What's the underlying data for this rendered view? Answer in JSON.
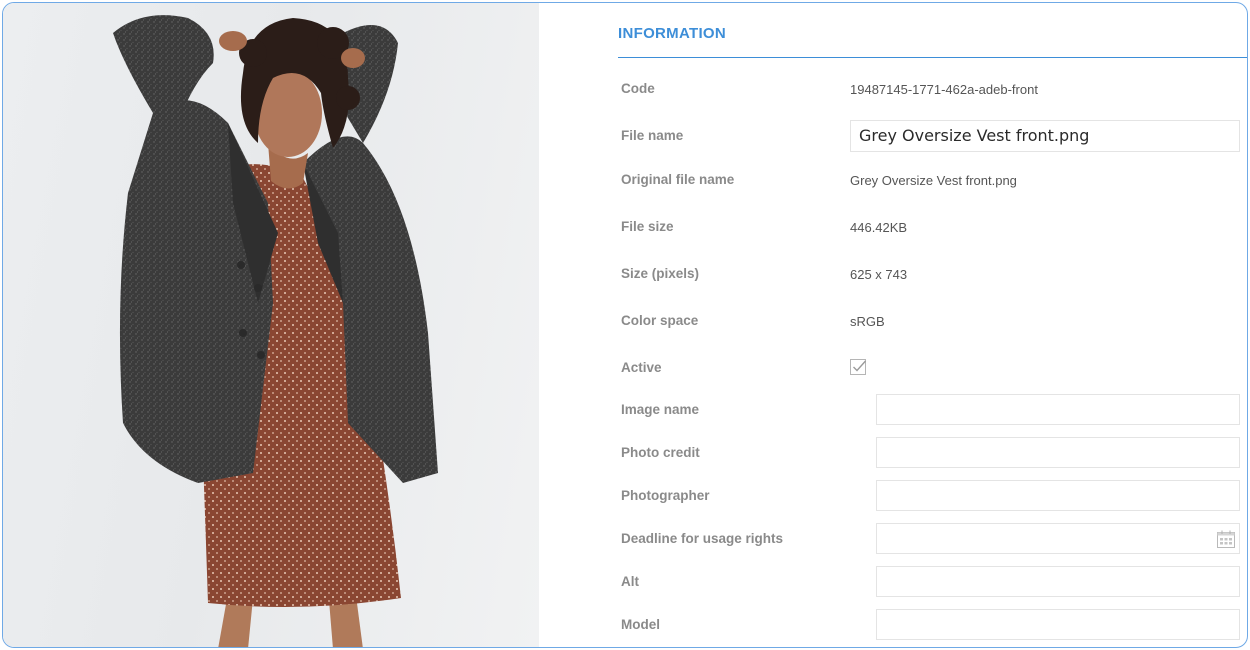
{
  "info": {
    "title": "INFORMATION",
    "fields": [
      {
        "label": "Code",
        "value": "19487145-1771-462a-adeb-front"
      },
      {
        "label": "File name",
        "value": "Grey Oversize Vest front.png"
      },
      {
        "label": "Original file name",
        "value": "Grey Oversize Vest front.png"
      },
      {
        "label": "File size",
        "value": "446.42KB"
      },
      {
        "label": "Size (pixels)",
        "value": "625 x 743"
      },
      {
        "label": "Color space",
        "value": "sRGB"
      },
      {
        "label": "Active",
        "checked": true
      },
      {
        "label": "Image name",
        "value": ""
      },
      {
        "label": "Photo credit",
        "value": ""
      },
      {
        "label": "Photographer",
        "value": ""
      },
      {
        "label": "Deadline for usage rights",
        "value": ""
      },
      {
        "label": "Alt",
        "value": ""
      },
      {
        "label": "Model",
        "value": ""
      }
    ]
  },
  "icons": {
    "checkbox": "checkbox-checked-icon",
    "calendar": "calendar-icon"
  },
  "colors": {
    "accent": "#3d8ed8",
    "frame_border": "#6fa9e6",
    "label": "#8a8a8a",
    "coat": "#3a3a3a",
    "dress": "#8a4632"
  }
}
